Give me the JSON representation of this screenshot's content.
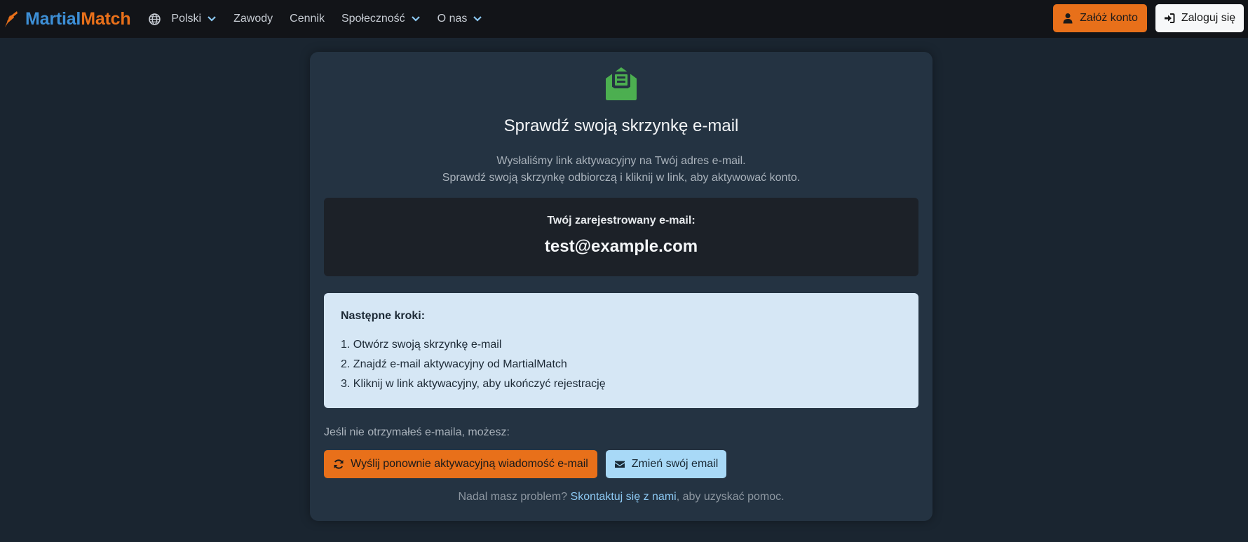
{
  "nav": {
    "brand_part1": "Martial",
    "brand_part2": "Match",
    "language": "Polski",
    "items": [
      {
        "label": "Zawody"
      },
      {
        "label": "Cennik"
      },
      {
        "label": "Społeczność"
      },
      {
        "label": "O nas"
      }
    ],
    "signup_label": "Załóż konto",
    "login_label": "Zaloguj się"
  },
  "card": {
    "icon": "envelope-open-icon",
    "title": "Sprawdź swoją skrzynkę e-mail",
    "desc_line1": "Wysłaliśmy link aktywacyjny na Twój adres e-mail.",
    "desc_line2": "Sprawdź swoją skrzynkę odbiorczą i kliknij w link, aby aktywować konto.",
    "email_label": "Twój zarejestrowany e-mail:",
    "email_value": "test@example.com",
    "steps_title": "Następne kroki:",
    "steps": [
      "1. Otwórz swoją skrzynkę e-mail",
      "2. Znajdź e-mail aktywacyjny od MartialMatch",
      "3. Kliknij w link aktywacyjny, aby ukończyć rejestrację"
    ],
    "resend_intro": "Jeśli nie otrzymałeś e-maila, możesz:",
    "resend_button": "Wyślij ponownie aktywacyjną wiadomość e-mail",
    "change_button": "Zmień swój email",
    "help_prefix": "Nadal masz problem?",
    "help_link": "Skontaktuj się z nami",
    "help_suffix": ", aby uzyskać pomoc."
  },
  "colors": {
    "accent_orange": "#e8701a",
    "accent_blue": "#3d8fd6",
    "success_green": "#4caf50",
    "page_bg": "#1a2530",
    "card_bg": "#243342"
  }
}
